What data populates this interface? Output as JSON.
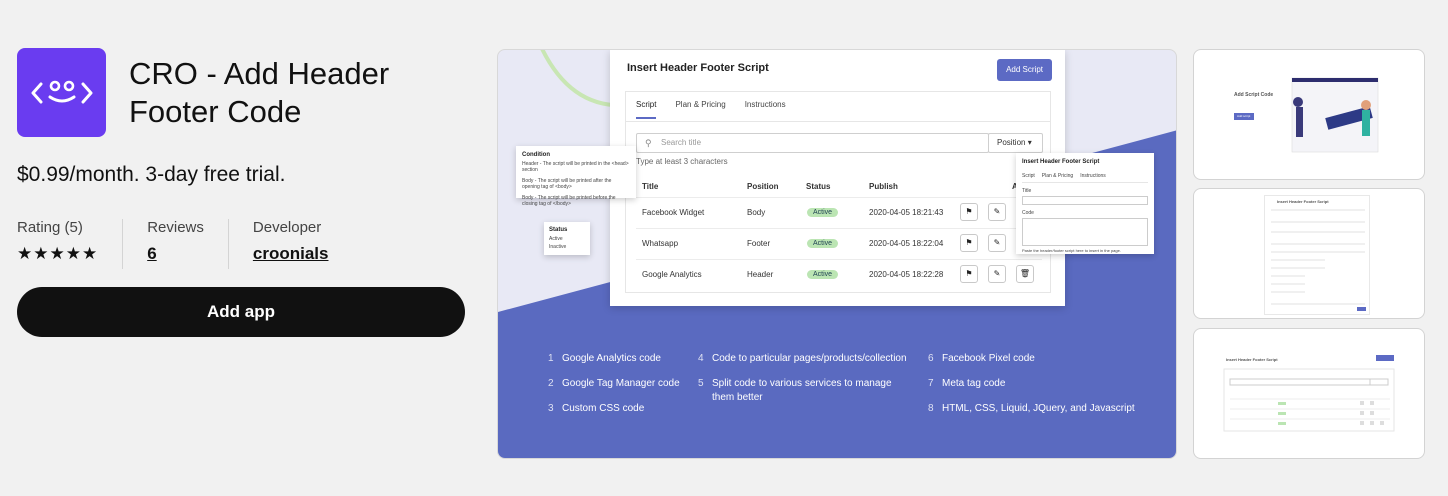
{
  "app": {
    "title": "CRO - Add Header Footer Code",
    "price": "$0.99/month. 3-day free trial.",
    "add_app_label": "Add app",
    "icon_color": "#6a3cf0"
  },
  "stats": {
    "rating_label": "Rating (5)",
    "rating_stars": "★★★★★",
    "rating_value": 5,
    "reviews_label": "Reviews",
    "reviews_count": "6",
    "developer_label": "Developer",
    "developer_name": "croonials"
  },
  "screenshot": {
    "admin_title": "Insert Header Footer Script",
    "add_script": "Add Script",
    "tabs": [
      "Script",
      "Plan & Pricing",
      "Instructions"
    ],
    "search_placeholder": "Search title",
    "position_select": "Position",
    "hint": "Type at least 3 characters",
    "columns": [
      "Title",
      "Position",
      "Status",
      "Publish",
      "Ac"
    ],
    "rows": [
      {
        "title": "Facebook Widget",
        "position": "Body",
        "status": "Active",
        "publish": "2020-04-05 18:21:43"
      },
      {
        "title": "Whatsapp",
        "position": "Footer",
        "status": "Active",
        "publish": "2020-04-05 18:22:04"
      },
      {
        "title": "Google Analytics",
        "position": "Header",
        "status": "Active",
        "publish": "2020-04-05 18:22:28"
      }
    ],
    "condition_card": {
      "title": "Condition",
      "options": [
        "Header - The script will be printed in the <head> section",
        "Body - The script will be printed after the opening tag of <body>",
        "Body - The script will be printed before the closing tag of </body>"
      ]
    },
    "status_card": {
      "title": "Status",
      "options": [
        "Active",
        "Inactive"
      ]
    },
    "popup": {
      "title": "Insert Header Footer Script",
      "tabs": [
        "Script",
        "Plan & Pricing",
        "Instructions"
      ],
      "field1": "Title",
      "field2": "Code",
      "note": "Paste the header/footer script here to insert in the page."
    },
    "features": [
      {
        "num": "1",
        "text": "Google Analytics code"
      },
      {
        "num": "2",
        "text": "Google Tag Manager code"
      },
      {
        "num": "3",
        "text": "Custom CSS code"
      },
      {
        "num": "4",
        "text": "Code to particular pages/products/collection"
      },
      {
        "num": "5",
        "text": "Split code to various services to manage them better"
      },
      {
        "num": "6",
        "text": "Facebook Pixel code"
      },
      {
        "num": "7",
        "text": "Meta tag code"
      },
      {
        "num": "8",
        "text": "HTML, CSS, Liquid, JQuery, and Javascript"
      }
    ]
  },
  "thumbnails": {
    "t1_heading": "Add Script Code",
    "t1_button": "Add script",
    "t2_title": "Insert Header Footer Script",
    "t3_title": "Insert Header Footer Script"
  }
}
